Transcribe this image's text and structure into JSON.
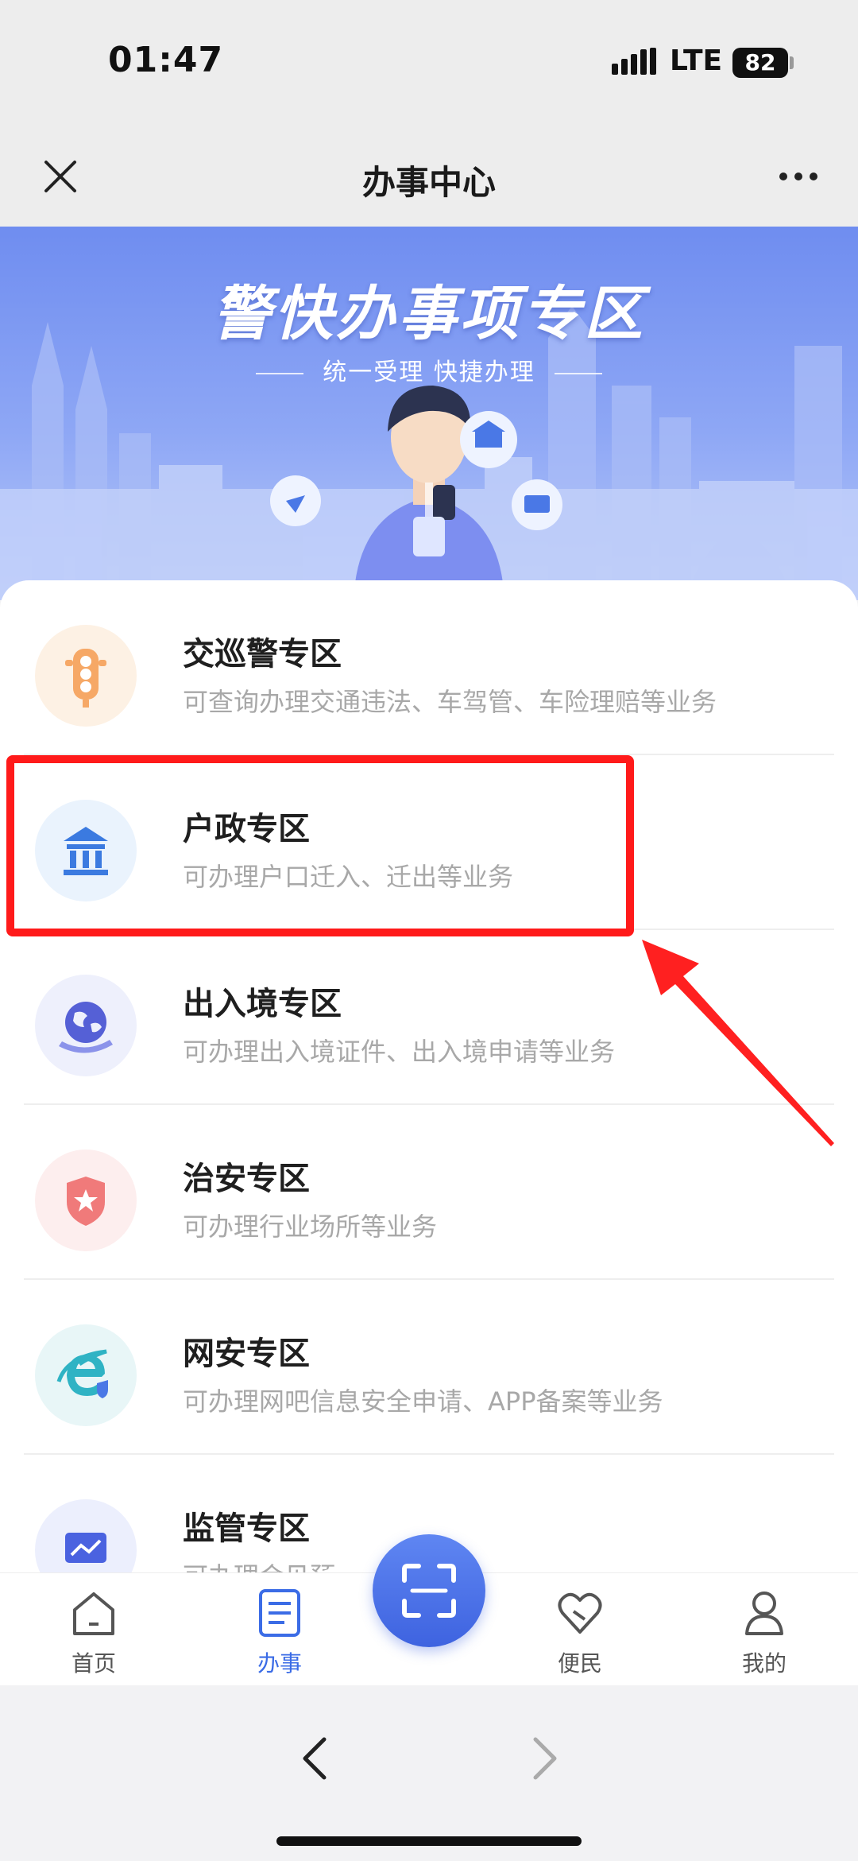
{
  "status_bar": {
    "time": "01:47",
    "network": "LTE",
    "battery": "82"
  },
  "nav": {
    "title": "办事中心",
    "close_icon": "close-icon",
    "more_icon": "more-icon"
  },
  "banner": {
    "title": "警快办事项专区",
    "subtitle": "统一受理  快捷办理"
  },
  "sections": [
    {
      "title": "交巡警专区",
      "desc": "可查询办理交通违法、车驾管、车险理赔等业务",
      "icon": "traffic-light-icon",
      "icon_bg": "#fdf1e4"
    },
    {
      "title": "户政专区",
      "desc": "可办理户口迁入、迁出等业务",
      "icon": "bank-icon",
      "icon_bg": "#eaf3fd"
    },
    {
      "title": "出入境专区",
      "desc": "可办理出入境证件、出入境申请等业务",
      "icon": "globe-icon",
      "icon_bg": "#eef0fc"
    },
    {
      "title": "治安专区",
      "desc": "可办理行业场所等业务",
      "icon": "shield-star-icon",
      "icon_bg": "#fdeeee"
    },
    {
      "title": "网安专区",
      "desc": "可办理网吧信息安全申请、APP备案等业务",
      "icon": "ie-shield-icon",
      "icon_bg": "#e8f6f7"
    },
    {
      "title": "监管专区",
      "desc": "可办理会见预约等业务",
      "icon": "monitor-chart-icon",
      "icon_bg": "#eceffd"
    }
  ],
  "tabs": [
    {
      "label": "首页",
      "icon": "home-icon"
    },
    {
      "label": "办事",
      "icon": "document-icon",
      "active": true
    },
    {
      "label": "便民",
      "icon": "heart-icon"
    },
    {
      "label": "我的",
      "icon": "user-icon"
    }
  ],
  "scan_icon": "scan-icon",
  "colors": {
    "accent": "#3b6ce6",
    "highlight": "#ff1a1a",
    "banner": "#7b97f2"
  }
}
